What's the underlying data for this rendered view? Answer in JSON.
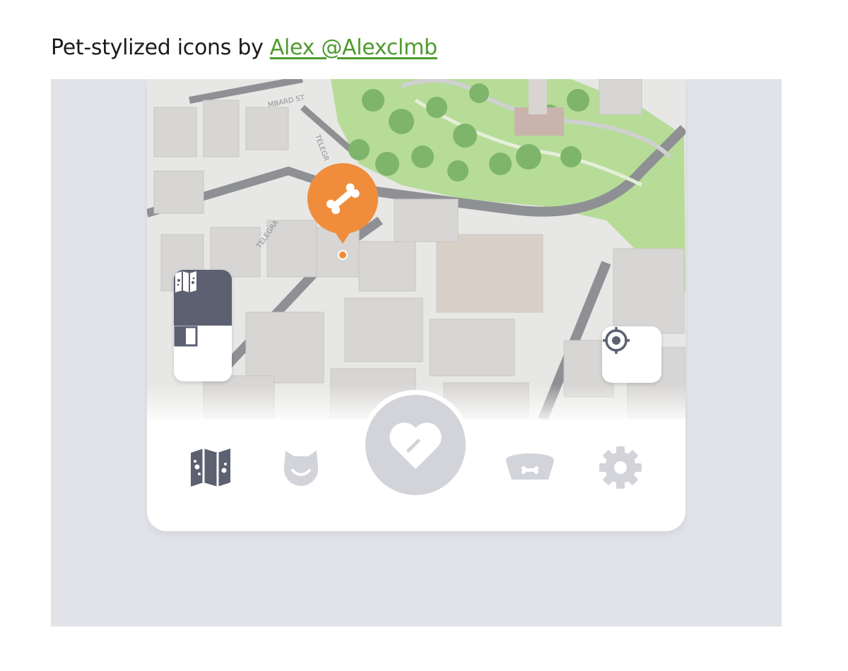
{
  "header": {
    "title_prefix": "Pet-stylized icons by ",
    "author_link": "Alex @Alexclmb"
  },
  "colors": {
    "accent_orange": "#f08d3c",
    "dark_icon": "#5c6070",
    "inactive_icon": "#d3d4da",
    "link_green": "#4f9a2e",
    "park_green": "#a9d68a"
  },
  "map": {
    "street_labels": [
      "MBARD ST",
      "TELEGR",
      "TELEGRA"
    ],
    "pin_icon": "bone-icon"
  },
  "map_controls": {
    "mode_active_icon": "paw-map-icon",
    "mode_inactive_icon": "split-square-icon",
    "locate_icon": "crosshair-icon"
  },
  "tabbar": {
    "items": [
      {
        "icon": "paw-map-icon",
        "state": "active"
      },
      {
        "icon": "pet-face-icon",
        "state": "inactive"
      },
      {
        "icon": "heart-icon",
        "state": "center"
      },
      {
        "icon": "pet-bowl-icon",
        "state": "inactive"
      },
      {
        "icon": "gear-icon",
        "state": "inactive"
      }
    ]
  }
}
